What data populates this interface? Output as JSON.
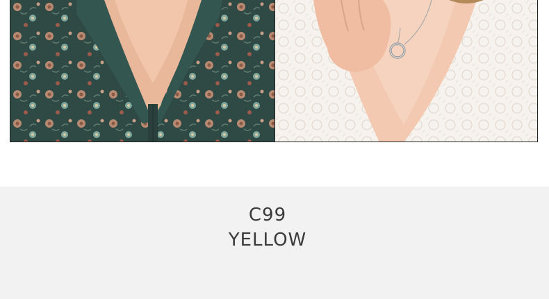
{
  "product_photos": {
    "left": {
      "icon": "floral-shirt-photo"
    },
    "right": {
      "icon": "lace-top-necklace-photo"
    }
  },
  "color_option": {
    "code": "C99",
    "name": "YELLOW"
  },
  "colors": {
    "panel_background": "#f2f2f2",
    "caption_text": "#3a3a3a",
    "shirt_base": "#2f4a45",
    "lace_base": "#f4efe9",
    "skin": "#f3c9b1"
  }
}
